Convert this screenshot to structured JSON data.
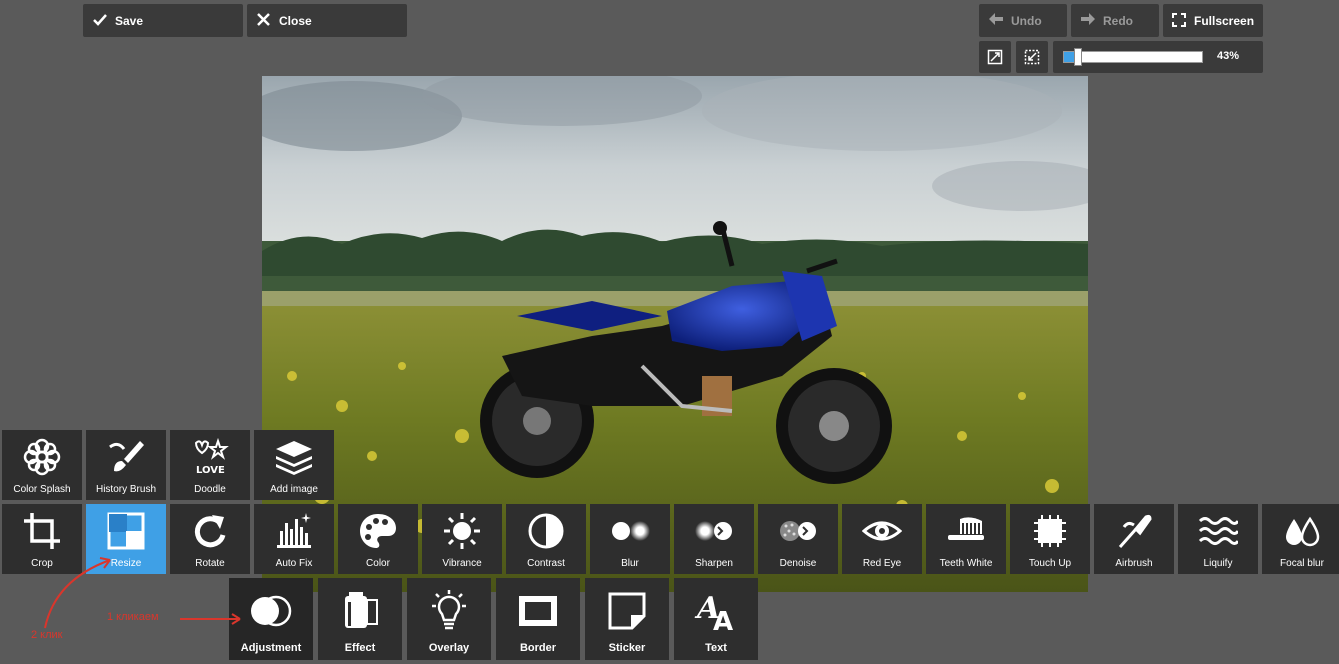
{
  "topbar": {
    "save_label": "Save",
    "close_label": "Close",
    "undo_label": "Undo",
    "redo_label": "Redo",
    "fullscreen_label": "Fullscreen",
    "zoom_value": 0.43,
    "zoom_label": "43%"
  },
  "tools_row1": [
    {
      "label": "Color Splash",
      "icon": "flower-icon"
    },
    {
      "label": "History Brush",
      "icon": "brush-icon"
    },
    {
      "label": "Doodle",
      "icon": "doodle-icon"
    },
    {
      "label": "Add image",
      "icon": "layers-icon"
    }
  ],
  "tools_row2": [
    {
      "label": "Crop",
      "icon": "crop-icon"
    },
    {
      "label": "Resize",
      "icon": "resize-icon",
      "active": true
    },
    {
      "label": "Rotate",
      "icon": "rotate-icon"
    },
    {
      "label": "Auto Fix",
      "icon": "autofix-icon"
    },
    {
      "label": "Color",
      "icon": "palette-icon"
    },
    {
      "label": "Vibrance",
      "icon": "sun-icon"
    },
    {
      "label": "Contrast",
      "icon": "contrast-icon"
    },
    {
      "label": "Blur",
      "icon": "blur-icon"
    },
    {
      "label": "Sharpen",
      "icon": "sharpen-icon"
    },
    {
      "label": "Denoise",
      "icon": "denoise-icon"
    },
    {
      "label": "Red Eye",
      "icon": "eye-icon"
    },
    {
      "label": "Teeth White",
      "icon": "toothbrush-icon"
    },
    {
      "label": "Touch Up",
      "icon": "touchup-icon"
    },
    {
      "label": "Airbrush",
      "icon": "airbrush-icon"
    },
    {
      "label": "Liquify",
      "icon": "waves-icon"
    },
    {
      "label": "Focal blur",
      "icon": "drops-icon"
    }
  ],
  "categories": [
    {
      "label": "Adjustment",
      "icon": "circles-icon",
      "selected": true
    },
    {
      "label": "Effect",
      "icon": "film-icon"
    },
    {
      "label": "Overlay",
      "icon": "bulb-icon"
    },
    {
      "label": "Border",
      "icon": "frame-icon"
    },
    {
      "label": "Sticker",
      "icon": "sticker-icon"
    },
    {
      "label": "Text",
      "icon": "text-icon"
    }
  ],
  "annotations": {
    "click1": "1 кликаем",
    "click2": "2 клик"
  },
  "colors": {
    "accent": "#3fa0e6",
    "annotation": "#d9362c"
  }
}
